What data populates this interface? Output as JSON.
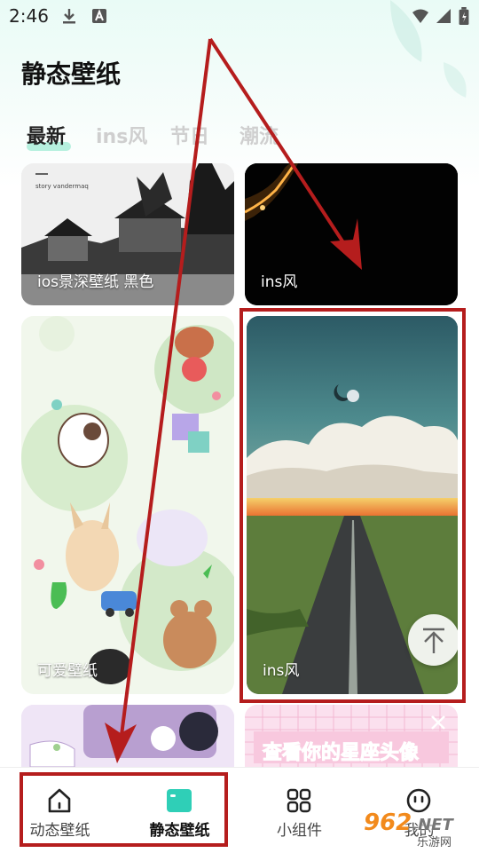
{
  "status": {
    "time": "2:46"
  },
  "header": {
    "title": "静态壁纸"
  },
  "tabs": [
    {
      "label": "最新",
      "active": true
    },
    {
      "label": "ins风",
      "active": false
    },
    {
      "label": "节日",
      "active": false
    },
    {
      "label": "潮流",
      "active": false
    }
  ],
  "cards": {
    "card1": {
      "label": "ios景深壁纸 黑色",
      "overlay_text": "story vandermaq"
    },
    "card2": {
      "label": "ins风"
    },
    "card3": {
      "label": "可爱壁纸"
    },
    "card4": {
      "label": "ins风"
    },
    "card6": {
      "banner_text": "查看你的星座头像"
    }
  },
  "nav": [
    {
      "label": "动态壁纸",
      "icon": "home-icon",
      "active": false
    },
    {
      "label": "静态壁纸",
      "icon": "wallpaper-icon",
      "active": true
    },
    {
      "label": "小组件",
      "icon": "widgets-icon",
      "active": false
    },
    {
      "label": "我的",
      "icon": "smiley-icon",
      "active": false
    }
  ],
  "watermark": {
    "brand": "962",
    "suffix": ".NET",
    "sub": "乐游网"
  },
  "colors": {
    "accent": "#2fcfb7",
    "annotation": "#b51d1d"
  }
}
